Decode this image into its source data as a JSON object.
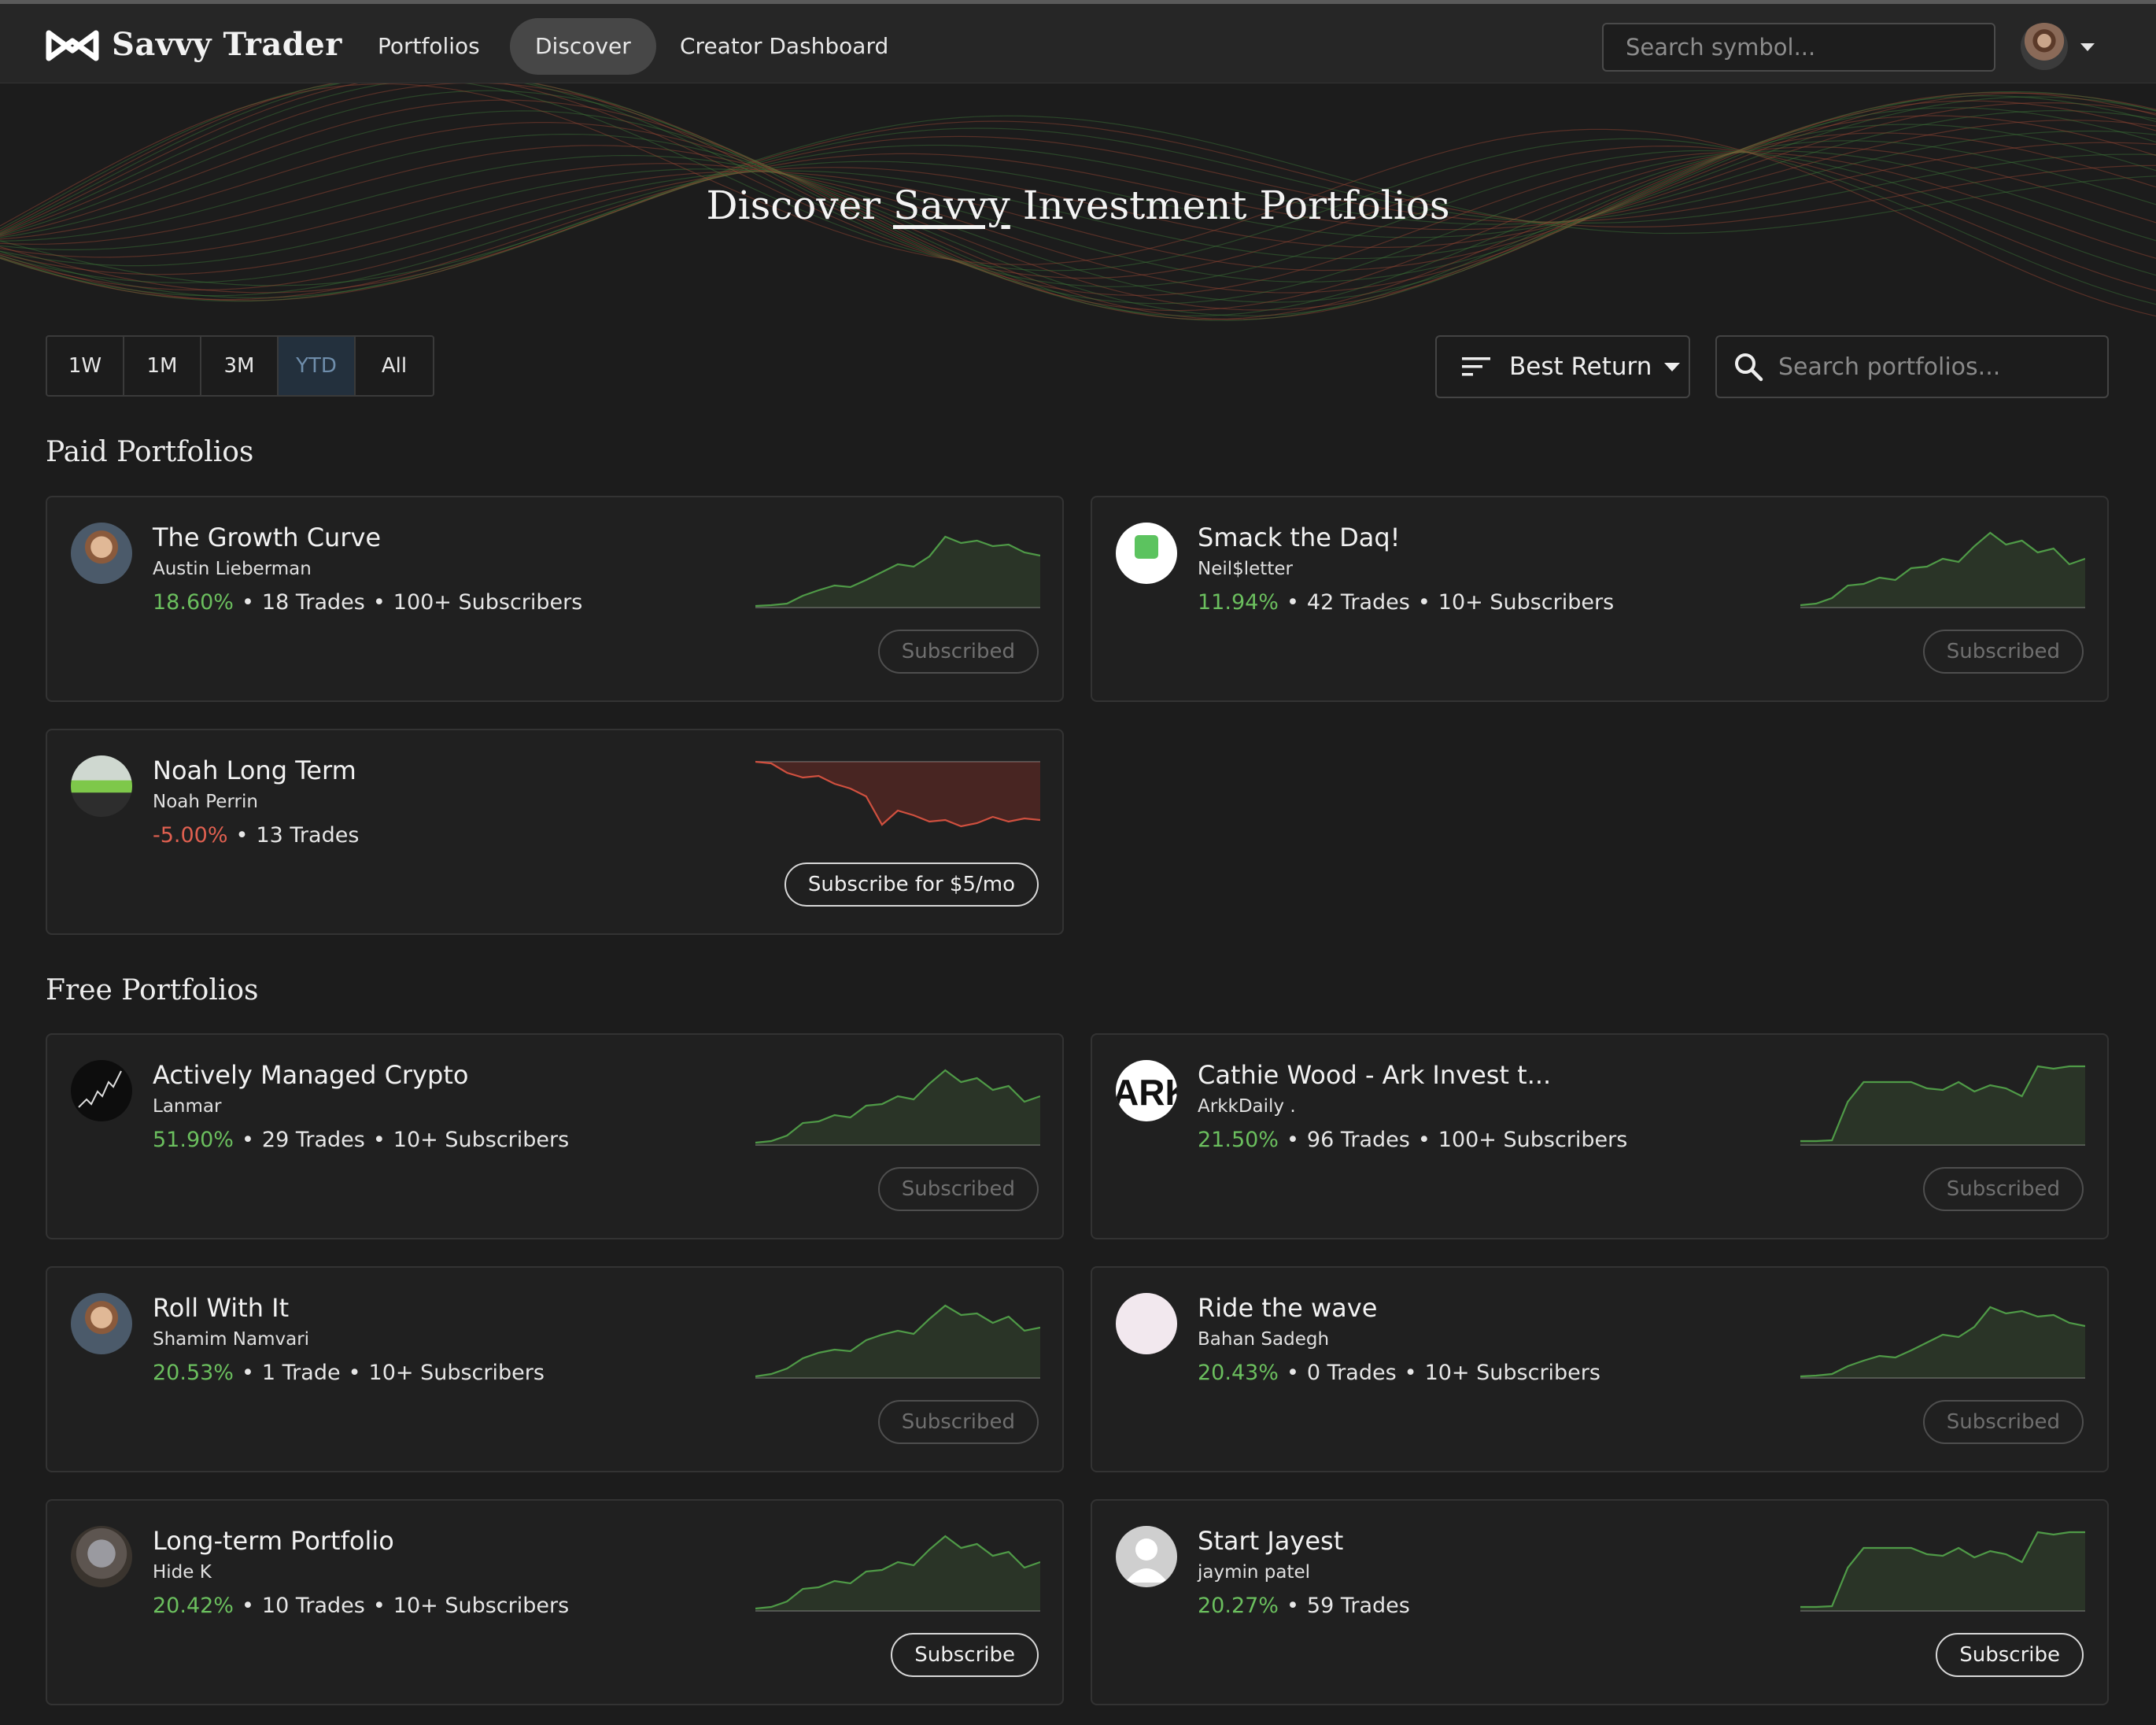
{
  "nav": {
    "brand": "Savvy Trader",
    "items": [
      {
        "label": "Portfolios",
        "active": false
      },
      {
        "label": "Discover",
        "active": true
      },
      {
        "label": "Creator Dashboard",
        "active": false
      }
    ],
    "symbol_search_placeholder": "Search symbol..."
  },
  "hero": {
    "title_pre": "Discover ",
    "title_underlined": "Savvy",
    "title_post": " Investment Portfolios"
  },
  "filters": {
    "ranges": [
      "1W",
      "1M",
      "3M",
      "YTD",
      "All"
    ],
    "active_range": "YTD",
    "sort_label": "Best Return",
    "portfolio_search_placeholder": "Search portfolios..."
  },
  "sections": {
    "paid_title": "Paid Portfolios",
    "free_title": "Free Portfolios"
  },
  "colors": {
    "positive": "#6bbf5e",
    "negative": "#e06050",
    "active_range": "#6f8eac"
  },
  "paid": [
    {
      "name": "The Growth Curve",
      "author": "Austin Lieberman",
      "return": "18.60%",
      "direction": "up",
      "trades": "18 Trades",
      "subscribers": "100+ Subscribers",
      "button": "Subscribed",
      "subscribed": true,
      "avatar": "person-photo-avatar"
    },
    {
      "name": "Smack the Daq!",
      "author": "Neil$letter",
      "return": "11.94%",
      "direction": "up",
      "trades": "42 Trades",
      "subscribers": "10+ Subscribers",
      "button": "Subscribed",
      "subscribed": true,
      "avatar": "green-heart-logo-avatar"
    },
    {
      "name": "Noah Long Term",
      "author": "Noah Perrin",
      "return": "-5.00%",
      "direction": "down",
      "trades": "13 Trades",
      "subscribers": "",
      "button": "Subscribe for $5/mo",
      "subscribed": false,
      "avatar": "green-car-avatar"
    }
  ],
  "free": [
    {
      "name": "Actively Managed Crypto",
      "author": "Lanmar",
      "return": "51.90%",
      "direction": "up",
      "trades": "29 Trades",
      "subscribers": "10+ Subscribers",
      "button": "Subscribed",
      "subscribed": true,
      "avatar": "chart-drawing-avatar"
    },
    {
      "name": "Cathie Wood - Ark Invest t...",
      "author": "ArkkDaily .",
      "return": "21.50%",
      "direction": "up",
      "trades": "96 Trades",
      "subscribers": "100+ Subscribers",
      "button": "Subscribed",
      "subscribed": true,
      "avatar": "ark-logo-avatar"
    },
    {
      "name": "Roll With It",
      "author": "Shamim Namvari",
      "return": "20.53%",
      "direction": "up",
      "trades": "1 Trade",
      "subscribers": "10+ Subscribers",
      "button": "Subscribed",
      "subscribed": true,
      "avatar": "person-photo-avatar"
    },
    {
      "name": "Ride the wave",
      "author": "Bahan Sadegh",
      "return": "20.43%",
      "direction": "up",
      "trades": "0 Trades",
      "subscribers": "10+ Subscribers",
      "button": "Subscribed",
      "subscribed": true,
      "avatar": "surfer-drawing-avatar"
    },
    {
      "name": "Long-term Portfolio",
      "author": "Hide K",
      "return": "20.42%",
      "direction": "up",
      "trades": "10 Trades",
      "subscribers": "10+ Subscribers",
      "button": "Subscribe",
      "subscribed": false,
      "avatar": "koala-photo-avatar"
    },
    {
      "name": "Start Jayest",
      "author": "jaymin patel",
      "return": "20.27%",
      "direction": "up",
      "trades": "59 Trades",
      "subscribers": "",
      "button": "Subscribe",
      "subscribed": false,
      "avatar": "default-user-avatar"
    }
  ]
}
